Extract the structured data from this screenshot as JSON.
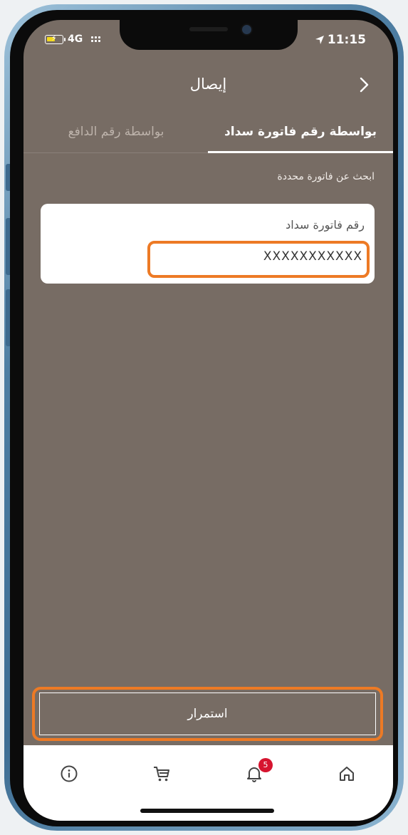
{
  "status_bar": {
    "network": "4G",
    "time": "11:15",
    "icons": [
      "battery-charging-icon",
      "signal-dots-icon",
      "location-arrow-icon"
    ]
  },
  "header": {
    "title": "إيصال",
    "back_icon": "chevron-right-icon"
  },
  "tabs": [
    {
      "label": "بواسطة رقم فاتورة سداد",
      "active": true
    },
    {
      "label": "بواسطة رقم الدافع",
      "active": false
    }
  ],
  "search": {
    "section_label": "ابحث عن فاتورة محددة",
    "field_label": "رقم فاتورة سداد",
    "field_value": "XXXXXXXXXXX"
  },
  "actions": {
    "continue_label": "استمرار"
  },
  "bottom_nav": {
    "items": [
      {
        "icon": "info-icon"
      },
      {
        "icon": "cart-icon"
      },
      {
        "icon": "bell-icon",
        "badge": "5"
      },
      {
        "icon": "home-icon"
      }
    ]
  },
  "colors": {
    "screen_background": "#776c64",
    "highlight": "#ed7a25",
    "badge": "#d6142f",
    "frame": "#4f7fa3"
  }
}
